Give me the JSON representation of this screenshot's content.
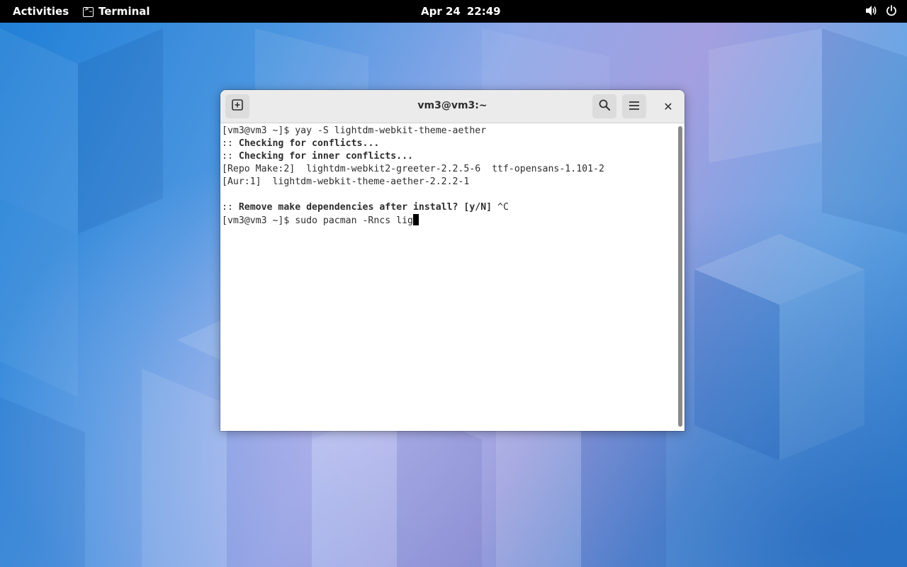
{
  "topbar": {
    "activities": "Activities",
    "app_name": "Terminal",
    "app_icon_glyph": ">_",
    "date": "Apr 24",
    "time": "22:49",
    "icons": [
      "volume-icon",
      "power-icon"
    ]
  },
  "window": {
    "title": "vm3@vm3:~",
    "buttons": [
      "new-tab-icon",
      "search-icon",
      "hamburger-menu-icon"
    ],
    "close_glyph": "✕"
  },
  "terminal": {
    "lines": [
      "[vm3@vm3 ~]$ yay -S lightdm-webkit-theme-aether",
      ":: Checking for conflicts...",
      ":: Checking for inner conflicts...",
      "[Repo Make:2]  lightdm-webkit2-greeter-2.2.5-6  ttf-opensans-1.101-2",
      "[Aur:1]  lightdm-webkit-theme-aether-2.2.2-1",
      "",
      ":: Remove make dependencies after install? [y/N] ^C",
      "[vm3@vm3 ~]$ sudo pacman -Rncs lig"
    ],
    "bold_segments": {
      "line1": "Checking for conflicts...",
      "line2": "Checking for inner conflicts...",
      "line6_bold": "Remove make dependencies after install? [y/N]"
    },
    "line6_rest": " ^C",
    "prompt_last": "[vm3@vm3 ~]$ sudo pacman -Rncs lig"
  },
  "colors": {
    "topbar_bg": "#000000",
    "headerbar_bg": "#ebebeb",
    "terminal_bg": "#ffffff",
    "terminal_fg": "#2e2e2e"
  }
}
